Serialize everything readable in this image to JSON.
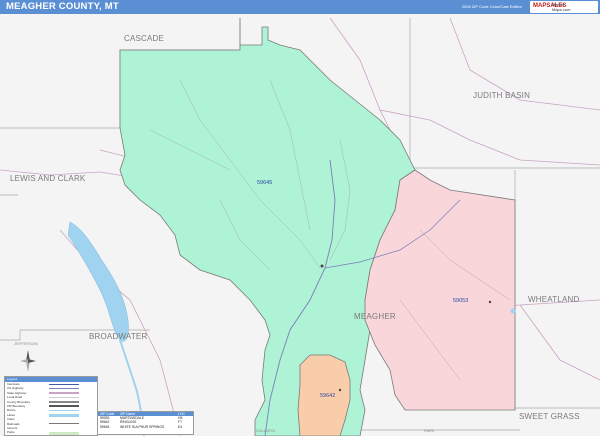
{
  "header": {
    "title": "MEAGHER COUNTY, MT",
    "edition": "2026 ZIP Code Color/Cast Edition",
    "logo_main": "MAPSALES",
    "logo_sub1": "Market",
    "logo_sub2": "Maps.com"
  },
  "colors": {
    "header": "#5b8fd4",
    "zip_59645": "#aef3d6",
    "zip_59053": "#f8d6da",
    "zip_59642": "#f9cdaa",
    "background": "#f4f4f4",
    "water": "#9fd3f0",
    "roads": "#c9a3c6"
  },
  "regions": {
    "cascade": "CASCADE",
    "judith_basin": "JUDITH BASIN",
    "lewis_and_clark": "LEWIS AND CLARK",
    "broadwater": "BROADWATER",
    "meagher": "MEAGHER",
    "wheatland": "WHEATLAND",
    "sweet_grass": "SWEET GRASS",
    "jefferson": "JEFFERSON",
    "gallatin": "GALLATIN",
    "park": "PARK"
  },
  "zips": {
    "z1": "59645",
    "z2": "59053",
    "z3": "59642"
  },
  "legend": {
    "title": "Legend",
    "items": [
      {
        "label": "Interstate"
      },
      {
        "label": "US Highway"
      },
      {
        "label": "State Highway"
      },
      {
        "label": "Local Road"
      },
      {
        "label": "County Boundary"
      },
      {
        "label": "ZIP Boundary"
      },
      {
        "label": "Rivers"
      },
      {
        "label": "Lakes"
      },
      {
        "label": "Cities"
      },
      {
        "label": "Railroads"
      },
      {
        "label": "Airports"
      },
      {
        "label": "Parks"
      }
    ]
  },
  "zip_table": {
    "headers": [
      "ZIP Code",
      "ZIP Name",
      "LOC"
    ],
    "rows": [
      {
        "zip": "59053",
        "name": "MARTINSDALE",
        "loc": "H5"
      },
      {
        "zip": "59642",
        "name": "RINGLING",
        "loc": "F7"
      },
      {
        "zip": "59645",
        "name": "WHITE SULPHUR SPRINGS",
        "loc": "E4"
      }
    ]
  }
}
